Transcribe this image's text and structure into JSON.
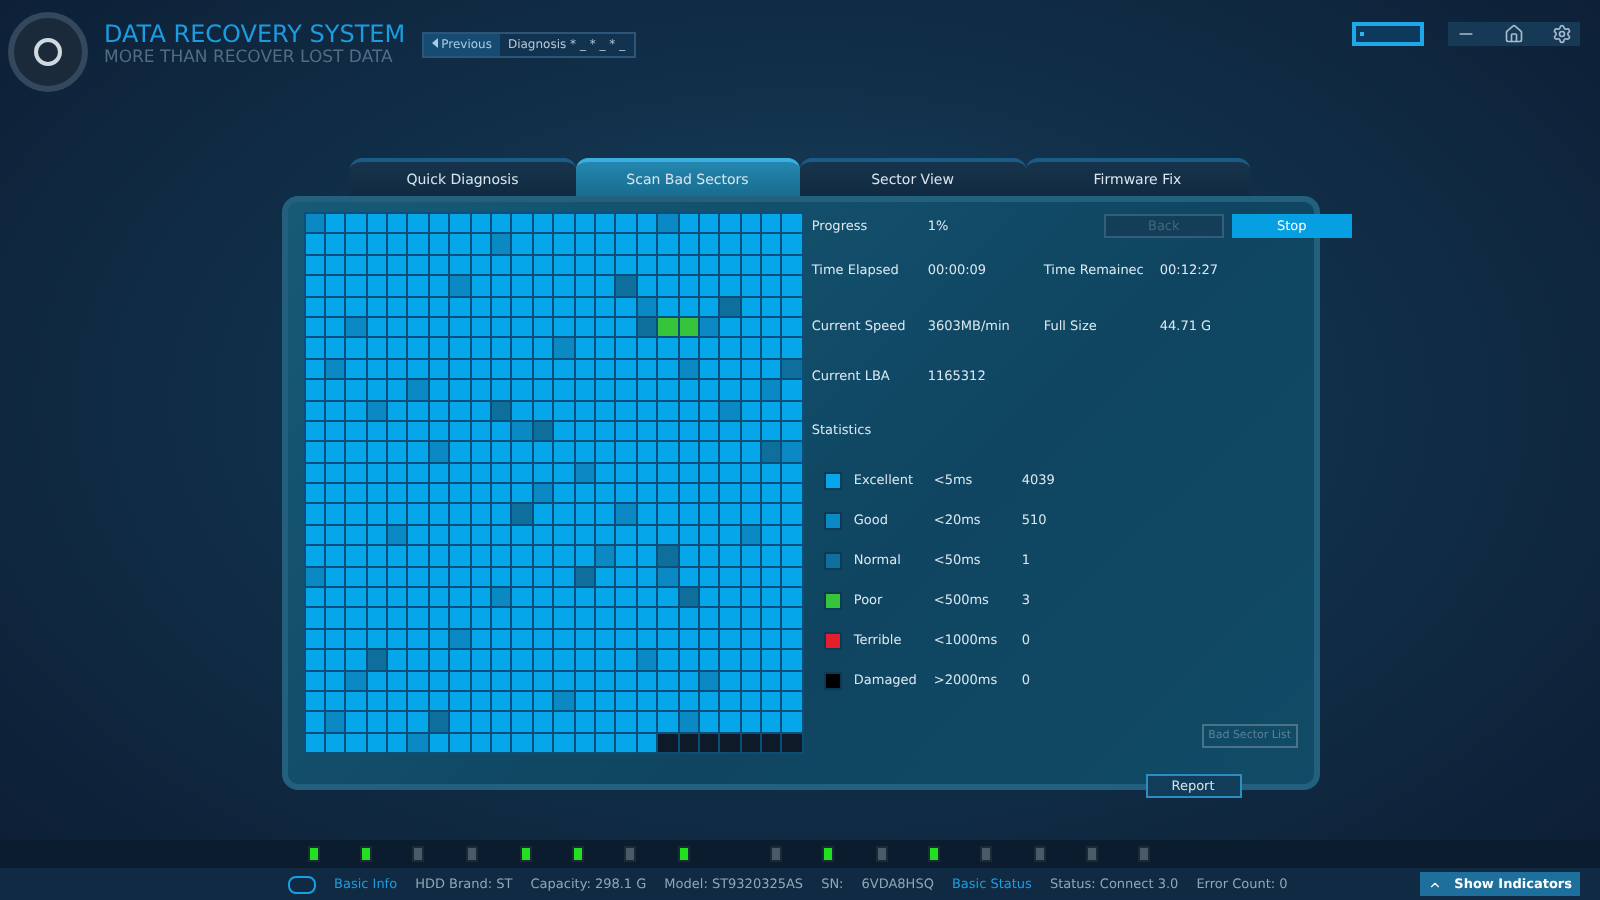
{
  "app": {
    "title": "DATA RECOVERY SYSTEM",
    "subtitle": "MORE THAN RECOVER LOST DATA"
  },
  "nav": {
    "previous": "Previous",
    "breadcrumb": "Diagnosis * _ * _ * _"
  },
  "tabs": [
    {
      "label": "Quick Diagnosis",
      "selected": false
    },
    {
      "label": "Scan Bad Sectors",
      "selected": true
    },
    {
      "label": "Sector View",
      "selected": false
    },
    {
      "label": "Firmware Fix",
      "selected": false
    }
  ],
  "scan": {
    "progress_label": "Progress",
    "progress": "1%",
    "buttons": [
      {
        "label": "Back",
        "disabled": true
      },
      {
        "label": "Stop",
        "disabled": false
      }
    ],
    "fields": [
      {
        "label": "Time Elapsed",
        "value": "00:00:09"
      },
      {
        "label": "Time Remainec",
        "value": "00:12:27"
      },
      {
        "label": "Current Speed",
        "value": "3603MB/min"
      },
      {
        "label": "Full Size",
        "value": "44.71 G"
      },
      {
        "label": "Current LBA",
        "value": "1165312"
      }
    ],
    "statistics_title": "Statistics",
    "statistics": [
      {
        "label": "Excellent",
        "threshold": "<5ms",
        "count": "4039",
        "color": "#05a6ea"
      },
      {
        "label": "Good",
        "threshold": "<20ms",
        "count": "510",
        "color": "#0b89c4"
      },
      {
        "label": "Normal",
        "threshold": "<50ms",
        "count": "1",
        "color": "#0e6e9c"
      },
      {
        "label": "Poor",
        "threshold": "<500ms",
        "count": "3",
        "color": "#35c43c"
      },
      {
        "label": "Terrible",
        "threshold": "<1000ms",
        "count": "0",
        "color": "#e0202e"
      },
      {
        "label": "Damaged",
        "threshold": ">2000ms",
        "count": "0",
        "color": "#000000"
      }
    ],
    "bad_sector_list": "Bad Sector List",
    "report": "Report"
  },
  "indicators": [
    {
      "on": true
    },
    {
      "on": true
    },
    {
      "on": false
    },
    {
      "on": false
    },
    {
      "on": true
    },
    {
      "on": true
    },
    {
      "on": false
    },
    {
      "on": true
    },
    {
      "on": false
    },
    {
      "on": true
    },
    {
      "on": false
    },
    {
      "on": true
    },
    {
      "on": false
    },
    {
      "on": false
    },
    {
      "on": false
    },
    {
      "on": false
    }
  ],
  "status_bar": {
    "basic_info": "Basic Info",
    "hdd_brand": "HDD Brand: ST",
    "capacity": "Capacity: 298.1 G",
    "model": "Model: ST9320325AS",
    "sn_label": "SN:",
    "sn": "6VDA8HSQ",
    "basic_status": "Basic Status",
    "status": "Status: Connect 3.0",
    "error_count": "Error Count: 0",
    "show_indicators": "Show Indicators"
  }
}
